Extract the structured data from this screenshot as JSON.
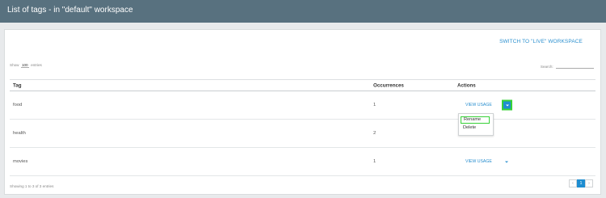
{
  "header": {
    "title": "List of tags - in \"default\" workspace"
  },
  "panel": {
    "switch_label": "SWITCH TO \"LIVE\" WORKSPACE",
    "show_prefix": "Show",
    "show_value": "100",
    "show_suffix": "entries",
    "search_label": "Search:",
    "search_value": ""
  },
  "table": {
    "columns": [
      "Tag",
      "Occurrences",
      "Actions"
    ],
    "rows": [
      {
        "tag": "food",
        "occurrences": "1",
        "action": "VIEW USAGE"
      },
      {
        "tag": "health",
        "occurrences": "2",
        "action": ""
      },
      {
        "tag": "movies",
        "occurrences": "1",
        "action": "VIEW USAGE"
      }
    ]
  },
  "dropdown": {
    "items": [
      "Rename",
      "Delete"
    ]
  },
  "footer": {
    "info": "Showing 1 to 3 of 3 entries"
  },
  "pager": {
    "prev": "‹",
    "current": "1",
    "next": "›"
  },
  "colors": {
    "header_bg": "#58717f",
    "accent": "#2a8fcf",
    "highlight": "#36d136"
  }
}
